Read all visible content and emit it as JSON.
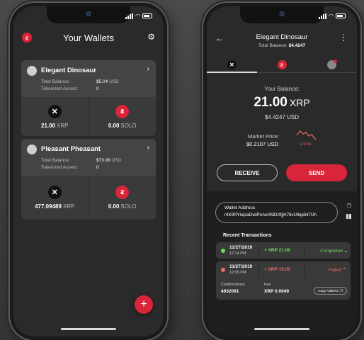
{
  "colors": {
    "accent": "#d8253a",
    "success": "#6ddc5a",
    "error": "#f06a6a"
  },
  "left": {
    "title": "Your Wallets",
    "icons": [
      "solo-logo-icon",
      "gear-icon"
    ],
    "wallets": [
      {
        "name": "Elegant Dinosaur",
        "total_balance_label": "Total Balance:",
        "total_balance_value": "$5.04",
        "total_balance_unit": "USD",
        "tokenized_label": "Tokenized Assets:",
        "tokenized_value": "0",
        "xrp_amount": "21.00",
        "xrp_unit": "XRP",
        "solo_amount": "0.00",
        "solo_unit": "SOLO"
      },
      {
        "name": "Pleasant Pheasant",
        "total_balance_label": "Total Balance:",
        "total_balance_value": "$73.99",
        "total_balance_unit": "USD",
        "tokenized_label": "Tokenized Assets:",
        "tokenized_value": "0",
        "xrp_amount": "477.09489",
        "xrp_unit": "XRP",
        "solo_amount": "0.00",
        "solo_unit": "SOLO"
      }
    ],
    "fab_label": "+"
  },
  "right": {
    "wallet_name": "Elegant Dinosaur",
    "total_balance_label": "Total Balance:",
    "total_balance_value": "$4.4247",
    "tabs": [
      "xrp-tab",
      "solo-tab",
      "other-asset-tab"
    ],
    "your_balance_label": "Your Balance:",
    "balance_amount": "21.00",
    "balance_unit": "XRP",
    "balance_usd": "$4.4247 USD",
    "market_price_label": "Market Price:",
    "market_price_value": "$0.2107 USD",
    "market_change": "-1.91%",
    "receive_label": "RECEIVE",
    "send_label": "SEND",
    "wallet_address_label": "Wallet Address",
    "wallet_address": "r4K9RYkqsaDvdPeAeAMDXfjjH76vUl6gdi47Uh",
    "recent_tx_title": "Recent Transactions",
    "transactions": [
      {
        "date": "11/27/2019",
        "time": "12:14 PM",
        "amount": "+ XRP 21.00",
        "status": "Completed",
        "status_color": "#6ddc5a"
      },
      {
        "date": "11/27/2019",
        "time": "12:05 PM",
        "amount": "+ XRP 15.00",
        "status": "Failed",
        "status_color": "#f06a6a",
        "confirmations_label": "Confirmations",
        "confirmations_value": "4932091",
        "fee_label": "Fee",
        "fee_value": "XRP 0.0049",
        "copy_address_label": "Copy Address"
      }
    ]
  }
}
